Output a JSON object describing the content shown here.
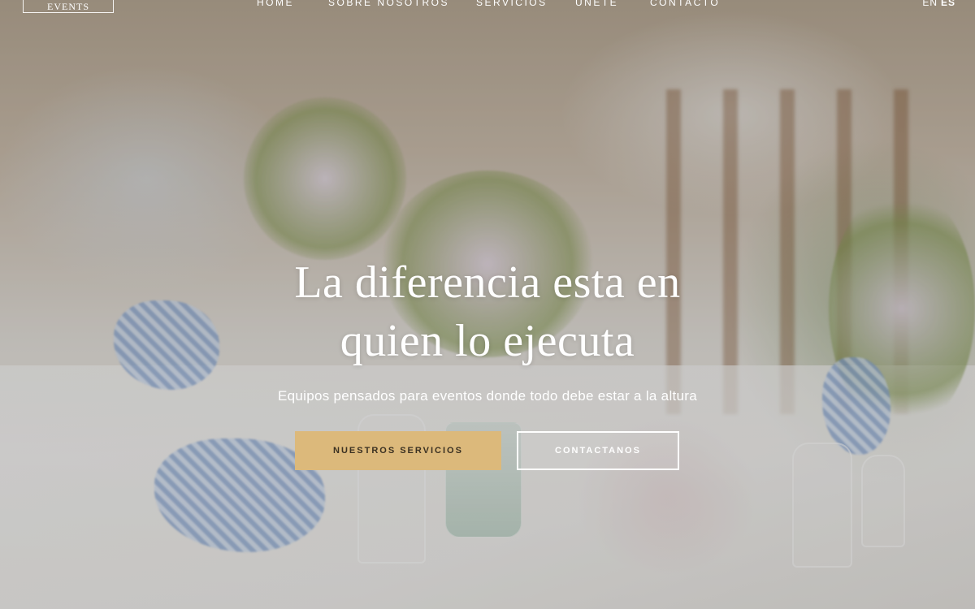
{
  "brand": {
    "logo_text": "EVENTS"
  },
  "nav": {
    "items": [
      {
        "label": "HOME"
      },
      {
        "label": "SOBRE NOSOTROS"
      },
      {
        "label": "SERVICIOS"
      },
      {
        "label": "UNETE"
      },
      {
        "label": "CONTACTO"
      }
    ]
  },
  "language": {
    "en": "EN",
    "es": "ES",
    "active": "ES"
  },
  "hero": {
    "title_line1": "La diferencia esta en",
    "title_line2": "quien lo ejecuta",
    "subtitle": "Equipos pensados para eventos donde todo debe estar a la altura",
    "primary_button": "NUESTROS SERVICIOS",
    "secondary_button": "CONTACTANOS"
  },
  "colors": {
    "accent": "#dcb97b",
    "accent_text": "#3b3122",
    "text_on_image": "#ffffff"
  }
}
